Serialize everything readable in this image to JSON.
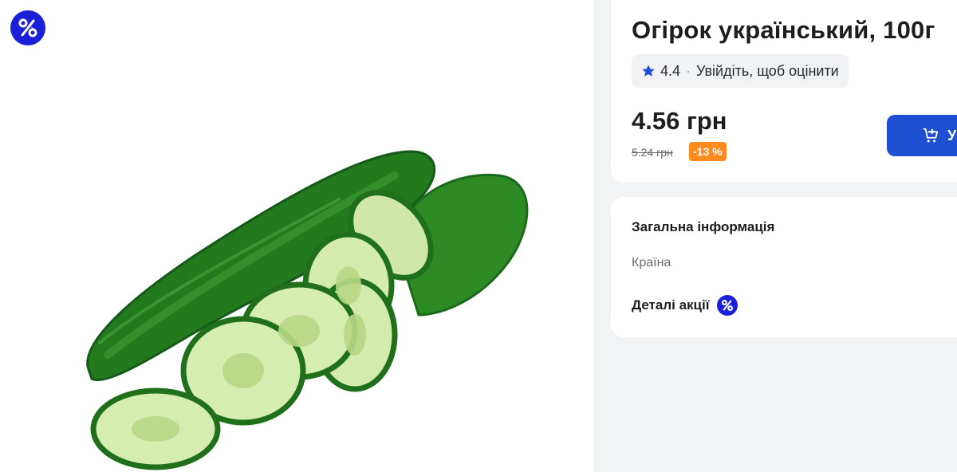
{
  "product": {
    "title": "Огірок український, 100г",
    "rating_value": "4.4",
    "rating_separator": "·",
    "rating_login_text": "Увійдіть, щоб оцінити",
    "price": "4.56 грн",
    "old_price": "5.24 грн",
    "discount": "-13 %",
    "cart_button_label": "У"
  },
  "info": {
    "section_title": "Загальна інформація",
    "country_label": "Країна",
    "promo_details_label": "Деталі акції"
  },
  "icons": {
    "promo": "percent-icon",
    "rating": "star-icon",
    "cart": "cart-add-icon"
  },
  "colors": {
    "accent_blue": "#1f4fd1",
    "promo_badge": "#1b20d8",
    "discount_orange": "#ff8a1e",
    "background": "#f2f3f5"
  }
}
